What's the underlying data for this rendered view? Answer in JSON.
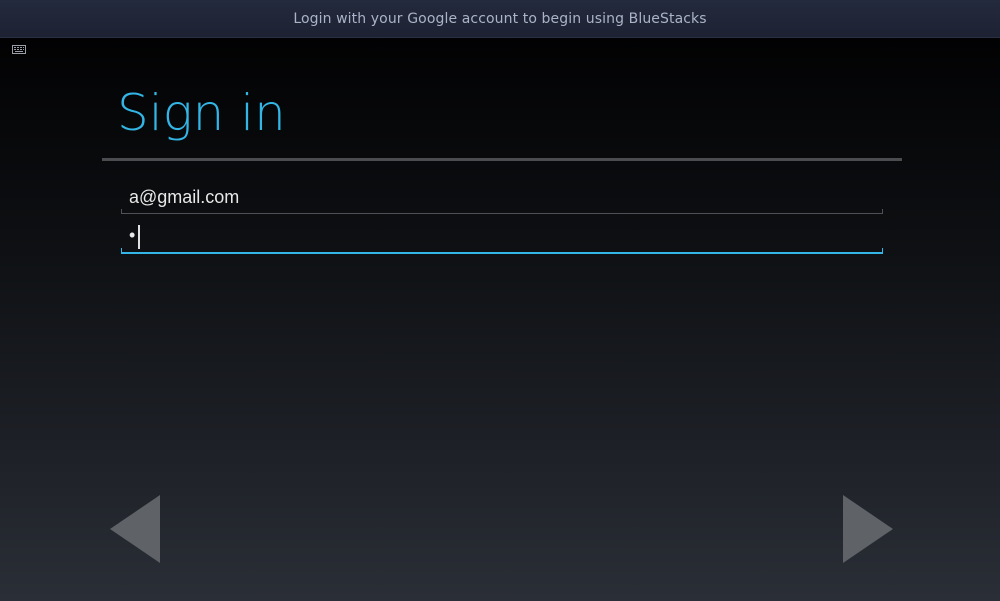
{
  "window": {
    "title": "Login with your Google account to begin using BlueStacks"
  },
  "screen": {
    "keyboard_icon": "keyboard-icon",
    "heading": "Sign in",
    "email_field": {
      "value": "a@gmail.com"
    },
    "password_field": {
      "masked_value": "•"
    },
    "nav": {
      "prev_icon": "left-arrow-icon",
      "next_icon": "right-arrow-icon"
    },
    "colors": {
      "accent": "#33b5e5",
      "arrow": "#5f6368"
    }
  }
}
